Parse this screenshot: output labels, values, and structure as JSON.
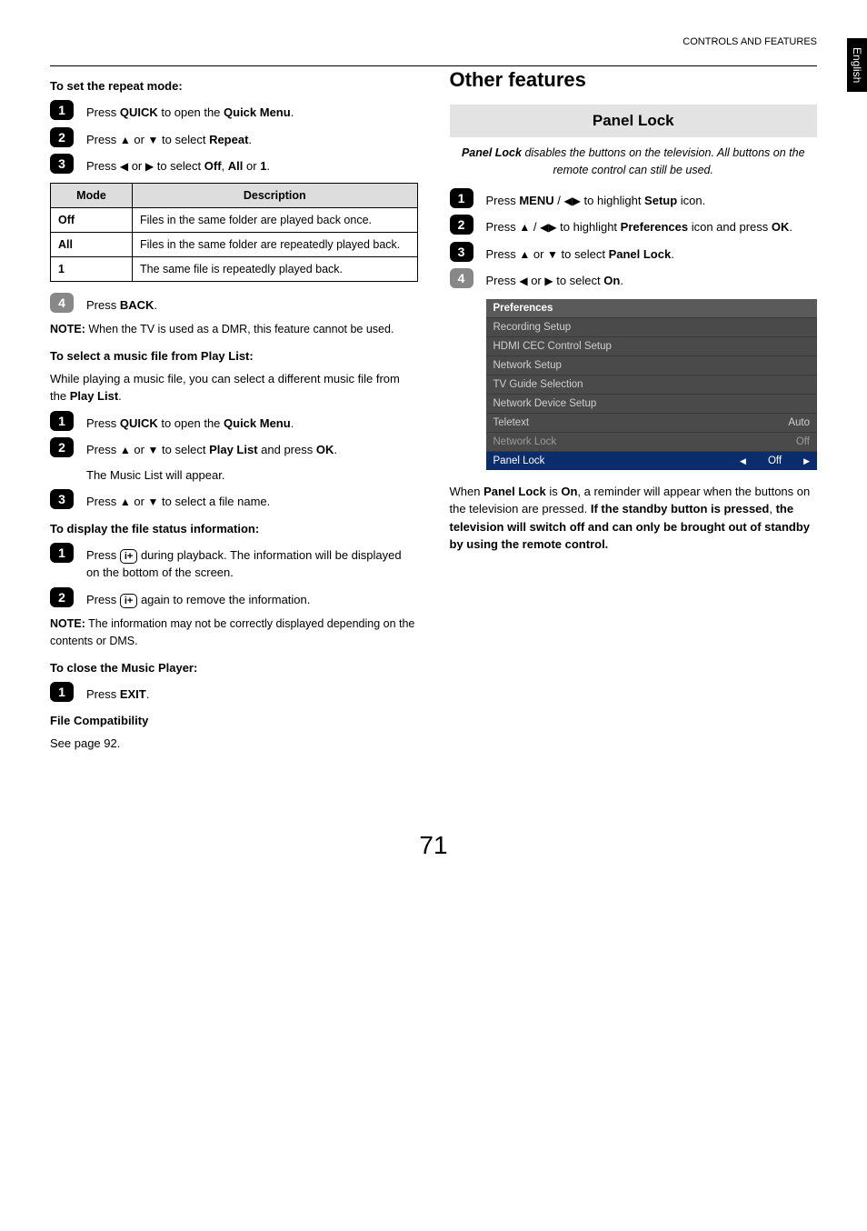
{
  "header": {
    "section_title": "CONTROLS AND FEATURES",
    "side_tab": "English"
  },
  "left": {
    "h_repeat": "To set the repeat mode:",
    "s1": {
      "pre": "Press ",
      "b1": "QUICK",
      "mid": " to open the ",
      "b2": "Quick Menu",
      "post": "."
    },
    "s2": {
      "pre": "Press ",
      "mid": " or ",
      "post": " to select ",
      "b": "Repeat",
      "end": "."
    },
    "s3": {
      "pre": "Press ",
      "mid": " or ",
      "post": " to select ",
      "b1": "Off",
      "sep": ", ",
      "b2": "All",
      "or": " or ",
      "b3": "1",
      "end": "."
    },
    "table": {
      "th1": "Mode",
      "th2": "Description",
      "r1c1": "Off",
      "r1c2": "Files in the same folder are played back once.",
      "r2c1": "All",
      "r2c2": "Files in the same folder are repeatedly played back.",
      "r3c1": "1",
      "r3c2": "The same file is repeatedly played back."
    },
    "s4": {
      "pre": "Press ",
      "b": "BACK",
      "post": "."
    },
    "note_dmr": {
      "label": "NOTE:",
      "text": " When the TV is used as a DMR, this feature cannot be used."
    },
    "h_music": "To select a music file from Play List:",
    "music_intro_a": "While playing a music file, you can select a different music file from the ",
    "music_intro_b": "Play List",
    "music_intro_c": ".",
    "m1": {
      "pre": "Press ",
      "b1": "QUICK",
      "mid": " to open the ",
      "b2": "Quick Menu",
      "post": "."
    },
    "m2": {
      "pre": "Press ",
      "mid": " or ",
      "post": " to select ",
      "b1": "Play List",
      "and": " and press ",
      "b2": "OK",
      "end": "."
    },
    "m2_sub": "The Music List will appear.",
    "m3": {
      "pre": "Press ",
      "mid": " or ",
      "post": " to select a file name."
    },
    "h_status": "To display the file status information:",
    "d1": {
      "pre": "Press ",
      "post": " during playback. The information will be displayed on the bottom of the screen."
    },
    "d2": {
      "pre": "Press ",
      "post": " again to remove the information."
    },
    "note_info": {
      "label": "NOTE:",
      "text": " The information may not be correctly displayed depending on the contents or DMS."
    },
    "h_close": "To close the Music Player:",
    "c1": {
      "pre": "Press ",
      "b": "EXIT",
      "post": "."
    },
    "h_compat": "File Compatibility",
    "compat_text": "See page 92."
  },
  "right": {
    "main_title": "Other features",
    "panel_lock_hdr": "Panel Lock",
    "panel_intro_a": "Panel Lock",
    "panel_intro_b": " disables the buttons on the television. All buttons on the remote control can still be used.",
    "p1": {
      "pre": "Press ",
      "b1": "MENU",
      "sep": " / ",
      "post": " to highlight ",
      "b2": "Setup",
      "end": " icon."
    },
    "p2": {
      "pre": "Press ",
      "sep": " / ",
      "post": " to highlight ",
      "b": "Preferences",
      "mid": " icon and press ",
      "b2": "OK",
      "end": "."
    },
    "p3": {
      "pre": "Press ",
      "mid": " or ",
      "post": " to select ",
      "b": "Panel Lock",
      "end": "."
    },
    "p4": {
      "pre": "Press ",
      "mid": " or ",
      "post": " to select ",
      "b": "On",
      "end": "."
    },
    "prefs": {
      "title": "Preferences",
      "rows": [
        {
          "label": "Recording Setup",
          "val": ""
        },
        {
          "label": "HDMI CEC Control Setup",
          "val": ""
        },
        {
          "label": "Network Setup",
          "val": ""
        },
        {
          "label": "TV Guide Selection",
          "val": ""
        },
        {
          "label": "Network Device Setup",
          "val": ""
        },
        {
          "label": "Teletext",
          "val": "Auto"
        },
        {
          "label": "Network Lock",
          "val": "Off",
          "dim": true
        },
        {
          "label": "Panel Lock",
          "val": "Off",
          "selected": true
        }
      ]
    },
    "outro_a": "When ",
    "outro_b": "Panel Lock",
    "outro_c": " is ",
    "outro_d": "On",
    "outro_e": ", a reminder will appear when the buttons on the television are pressed. ",
    "outro_f": "If the standby button is pressed",
    "outro_g": ", ",
    "outro_h": "the television will switch off and can only be brought out of standby by using the remote control."
  },
  "page_number": "71"
}
